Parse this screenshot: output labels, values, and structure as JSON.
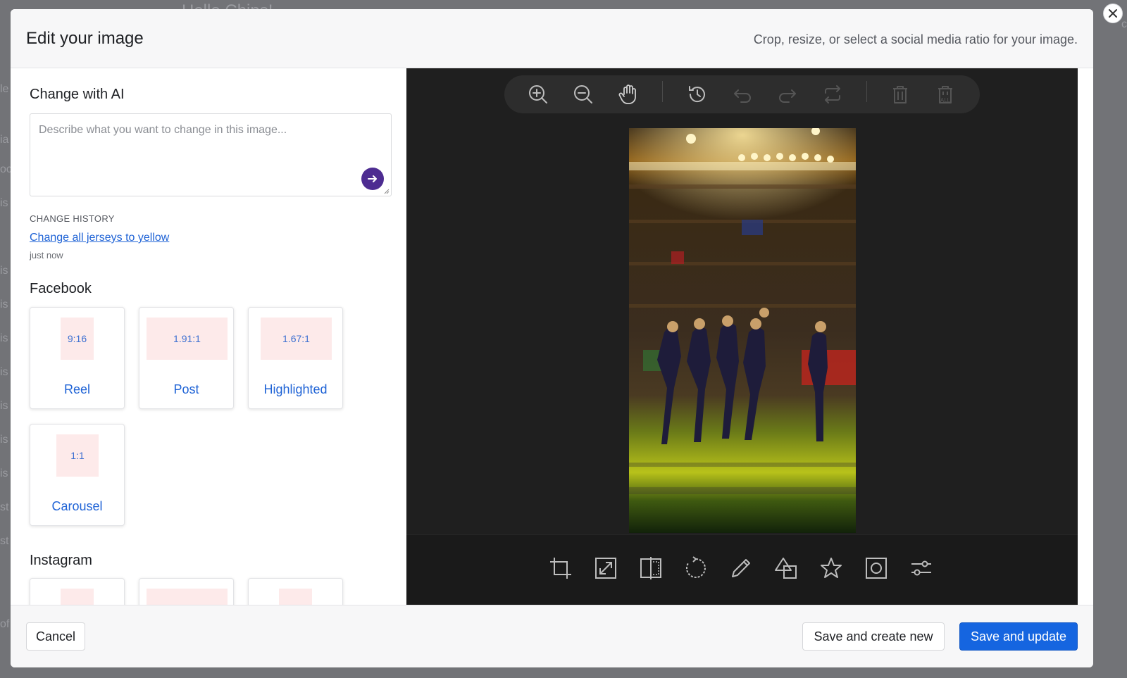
{
  "background": {
    "title": "Hello Chips!",
    "side_letters": [
      "le",
      "ia",
      "oc",
      "is",
      "is",
      "is",
      "is",
      "is",
      "is",
      "is",
      "is",
      "st",
      "st",
      "of"
    ],
    "right_letter": "c"
  },
  "modal": {
    "title": "Edit your image",
    "subtitle": "Crop, resize, or select a social media ratio for your image."
  },
  "ai": {
    "section_title": "Change with AI",
    "placeholder": "Describe what you want to change in this image...",
    "value": ""
  },
  "history": {
    "label": "CHANGE HISTORY",
    "items": [
      {
        "text": "Change all jerseys to yellow",
        "time": "just now"
      }
    ]
  },
  "facebook": {
    "section_title": "Facebook",
    "ratios": [
      {
        "ratio": "9:16",
        "label": "Reel"
      },
      {
        "ratio": "1.91:1",
        "label": "Post"
      },
      {
        "ratio": "1.67:1",
        "label": "Highlighted"
      },
      {
        "ratio": "1:1",
        "label": "Carousel"
      }
    ]
  },
  "instagram": {
    "section_title": "Instagram"
  },
  "toolbar": {
    "top_icons": [
      "zoom-in-icon",
      "zoom-out-icon",
      "hand-pan-icon",
      "history-icon",
      "undo-icon",
      "redo-icon",
      "reset-icon",
      "delete-icon",
      "delete-all-icon"
    ],
    "delete_all_text": "ALL",
    "bottom_icons": [
      "crop-icon",
      "resize-icon",
      "flip-icon",
      "rotate-icon",
      "draw-icon",
      "shape-icon",
      "icon-star-icon",
      "mask-icon",
      "filter-icon"
    ]
  },
  "footer": {
    "cancel_label": "Cancel",
    "save_new_label": "Save and create new",
    "save_update_label": "Save and update"
  },
  "colors": {
    "primary": "#1565e0",
    "link": "#1f63d6",
    "send": "#4d2c91",
    "editor_bg": "#1f1f1f"
  }
}
